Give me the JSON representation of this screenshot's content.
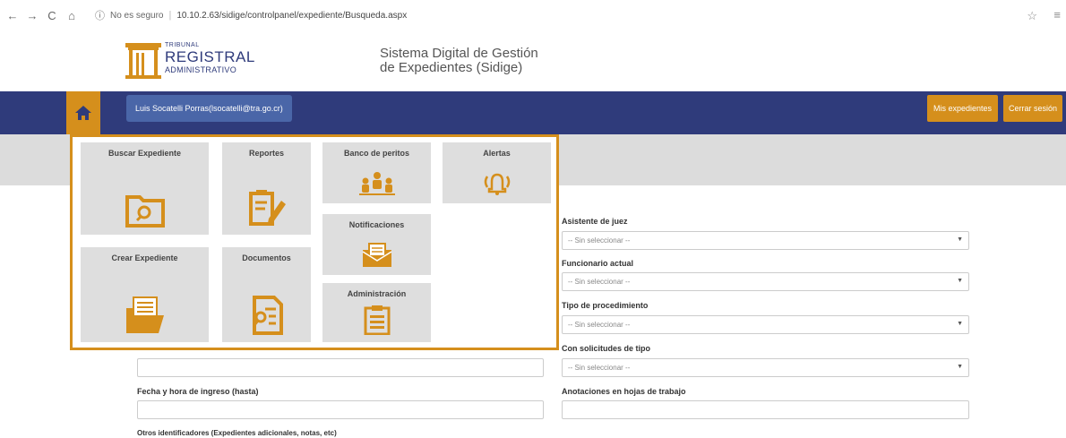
{
  "browser": {
    "insecure_label": "No es seguro",
    "url": "10.10.2.63/sidige/controlpanel/expediente/Busqueda.aspx"
  },
  "header": {
    "logo_small": "TRIBUNAL",
    "logo_big": "REGISTRAL",
    "logo_sub": "ADMINISTRATIVO",
    "system_title_line1": "Sistema Digital de Gestión",
    "system_title_line2": "de Expedientes (Sidige)"
  },
  "navbar": {
    "user": "Luis Socatelli Porras(lsocatelli@tra.go.cr)",
    "mis_expedientes": "Mis expedientes",
    "cerrar_sesion": "Cerrar sesión"
  },
  "menu": {
    "buscar": "Buscar Expediente",
    "reportes": "Reportes",
    "peritos": "Banco de peritos",
    "alertas": "Alertas",
    "notificaciones": "Notificaciones",
    "crear": "Crear Expediente",
    "documentos": "Documentos",
    "administracion": "Administración"
  },
  "form": {
    "asistente_label": "Asistente de juez",
    "asistente_value": "-- Sin seleccionar --",
    "funcionario_label": "Funcionario actual",
    "funcionario_value": "-- Sin seleccionar --",
    "tipo_label": "Tipo de procedimiento",
    "tipo_value": "-- Sin seleccionar --",
    "solicitudes_label": "Con solicitudes de tipo",
    "solicitudes_value": "-- Sin seleccionar --",
    "fecha_hasta_label": "Fecha y hora de ingreso (hasta)",
    "anotaciones_label": "Anotaciones en hojas de trabajo",
    "otros_label": "Otros identificadores (Expedientes adicionales, notas, etc)"
  },
  "colors": {
    "navy": "#2f3b7b",
    "orange": "#d58f1c",
    "tile_gray": "#dedede"
  }
}
